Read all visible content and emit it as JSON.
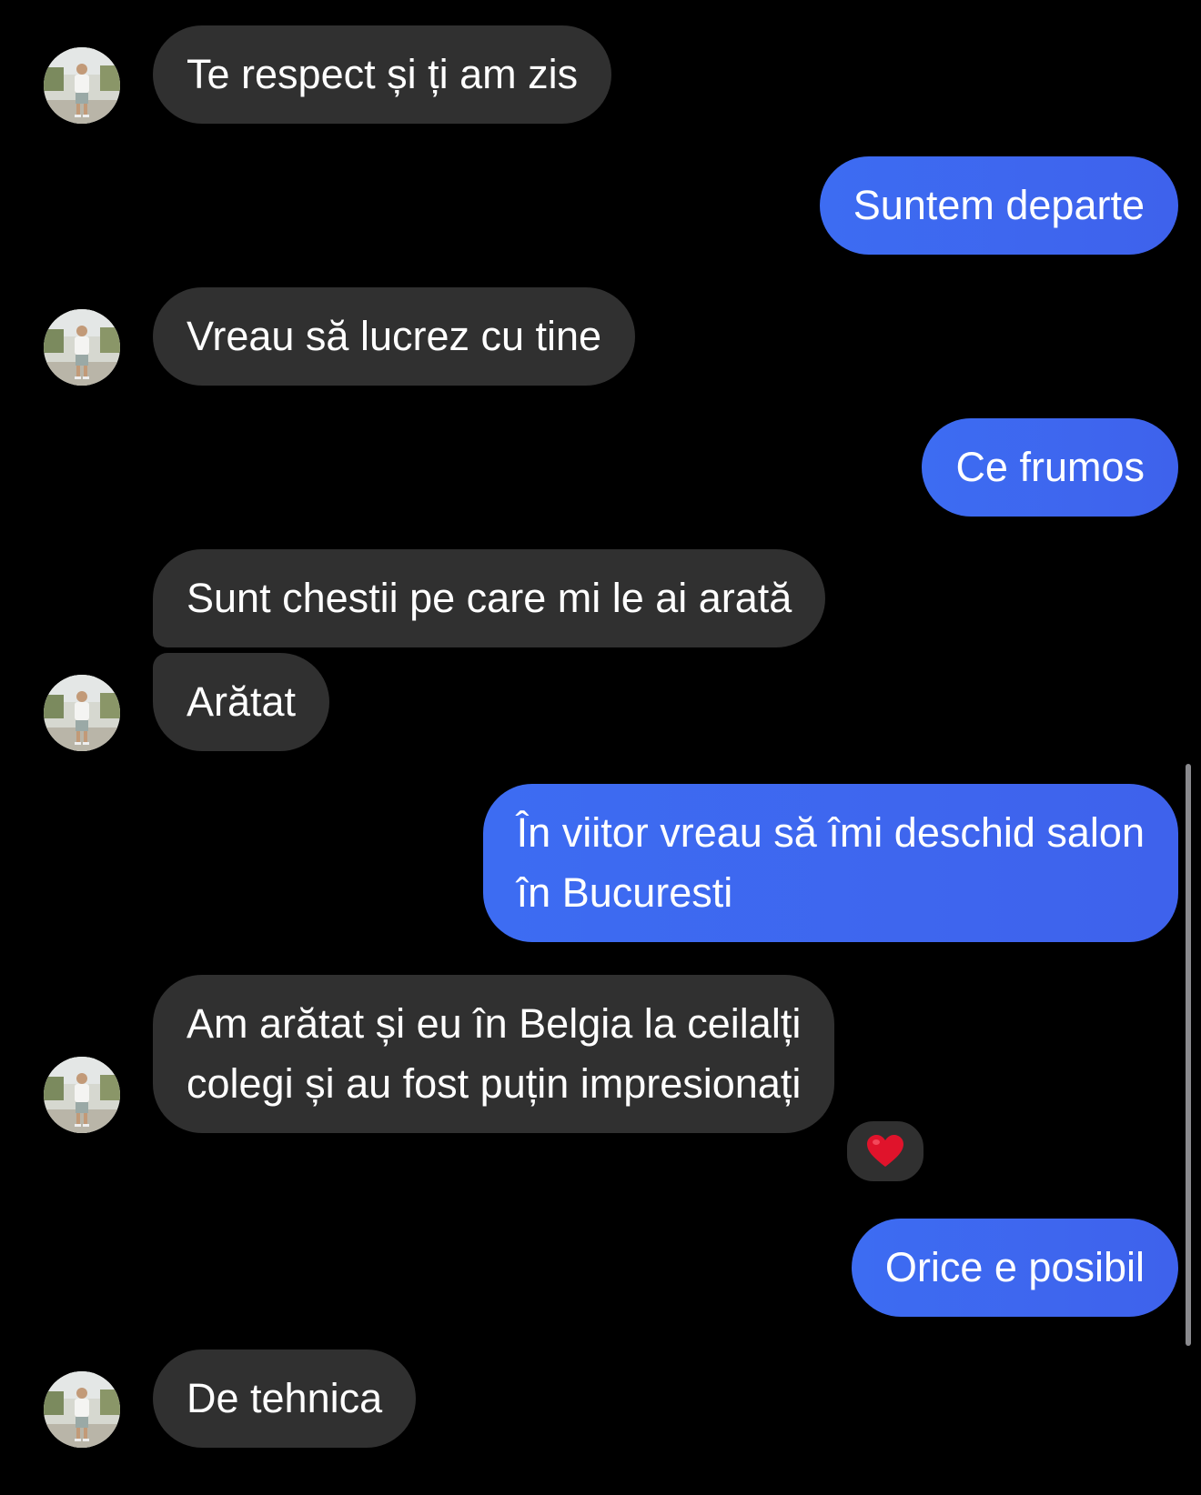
{
  "conversation": {
    "messages": [
      {
        "text": "Te respect și ți am zis"
      },
      {
        "text": "Suntem departe"
      },
      {
        "text": "Vreau să lucrez cu tine"
      },
      {
        "text": "Ce frumos"
      },
      {
        "text": "Sunt chestii pe care mi le ai arată"
      },
      {
        "text": "Arătat"
      },
      {
        "line1": "În viitor vreau să îmi deschid salon",
        "line2": "în Bucuresti"
      },
      {
        "line1": "Am arătat și eu în Belgia la ceilalți",
        "line2": "colegi și au fost puțin impresionați",
        "reaction": "heart"
      },
      {
        "text": "Orice e posibil"
      },
      {
        "text": "De tehnica"
      }
    ],
    "colors": {
      "background": "#000000",
      "incoming_bubble": "#303030",
      "outgoing_bubble": "#3d6cf2",
      "text": "#ffffff",
      "reaction_heart": "#e0132b"
    },
    "avatar_icon": "contact-photo-person-standing"
  }
}
